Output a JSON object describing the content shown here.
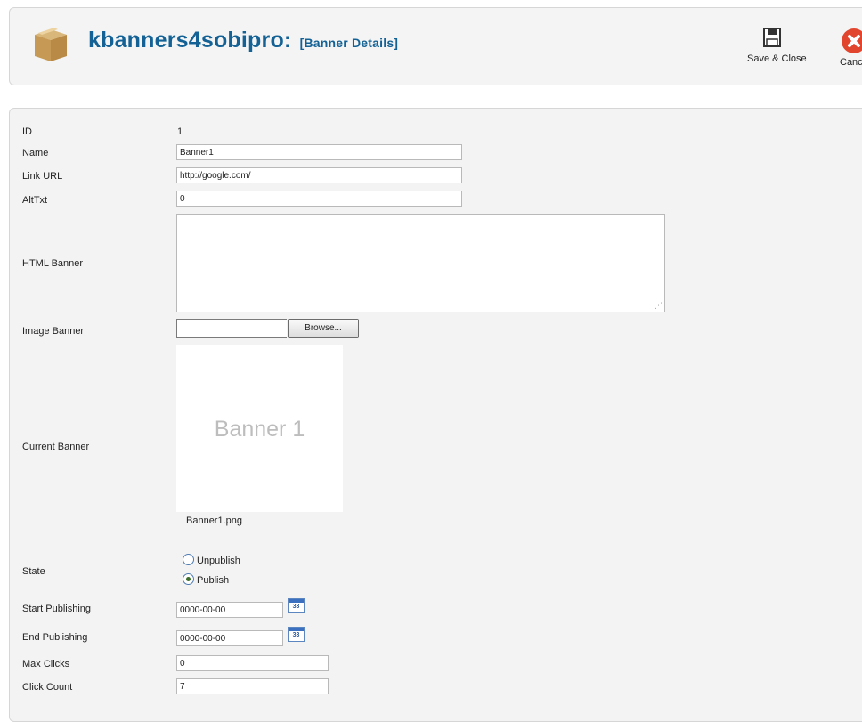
{
  "header": {
    "title": "kbanners4sobipro:",
    "subtitle": "[Banner Details]",
    "toolbar": {
      "save_close_label": "Save & Close",
      "cancel_label": "Cancel"
    }
  },
  "form": {
    "id": {
      "label": "ID",
      "value": "1"
    },
    "name": {
      "label": "Name",
      "value": "Banner1"
    },
    "link_url": {
      "label": "Link URL",
      "value": "http://google.com/"
    },
    "alt_txt": {
      "label": "AltTxt",
      "value": "0"
    },
    "html_banner": {
      "label": "HTML Banner",
      "value": ""
    },
    "image_banner": {
      "label": "Image Banner",
      "browse_label": "Browse..."
    },
    "current_banner": {
      "label": "Current Banner",
      "image_text": "Banner 1",
      "filename": "Banner1.png"
    },
    "state": {
      "label": "State",
      "options": [
        "Unpublish",
        "Publish"
      ],
      "selected": "Publish"
    },
    "start_publishing": {
      "label": "Start Publishing",
      "value": "0000-00-00",
      "calendar_icon_text": "33"
    },
    "end_publishing": {
      "label": "End Publishing",
      "value": "0000-00-00",
      "calendar_icon_text": "33"
    },
    "max_clicks": {
      "label": "Max Clicks",
      "value": "0"
    },
    "click_count": {
      "label": "Click Count",
      "value": "7"
    }
  },
  "colors": {
    "title": "#146295",
    "link": "#1f5d9a",
    "cancel_red": "#e2452d"
  },
  "icons": {
    "logo": "package-box-icon",
    "save": "floppy-disk-icon",
    "cancel": "cancel-x-icon",
    "calendar": "calendar-icon"
  }
}
